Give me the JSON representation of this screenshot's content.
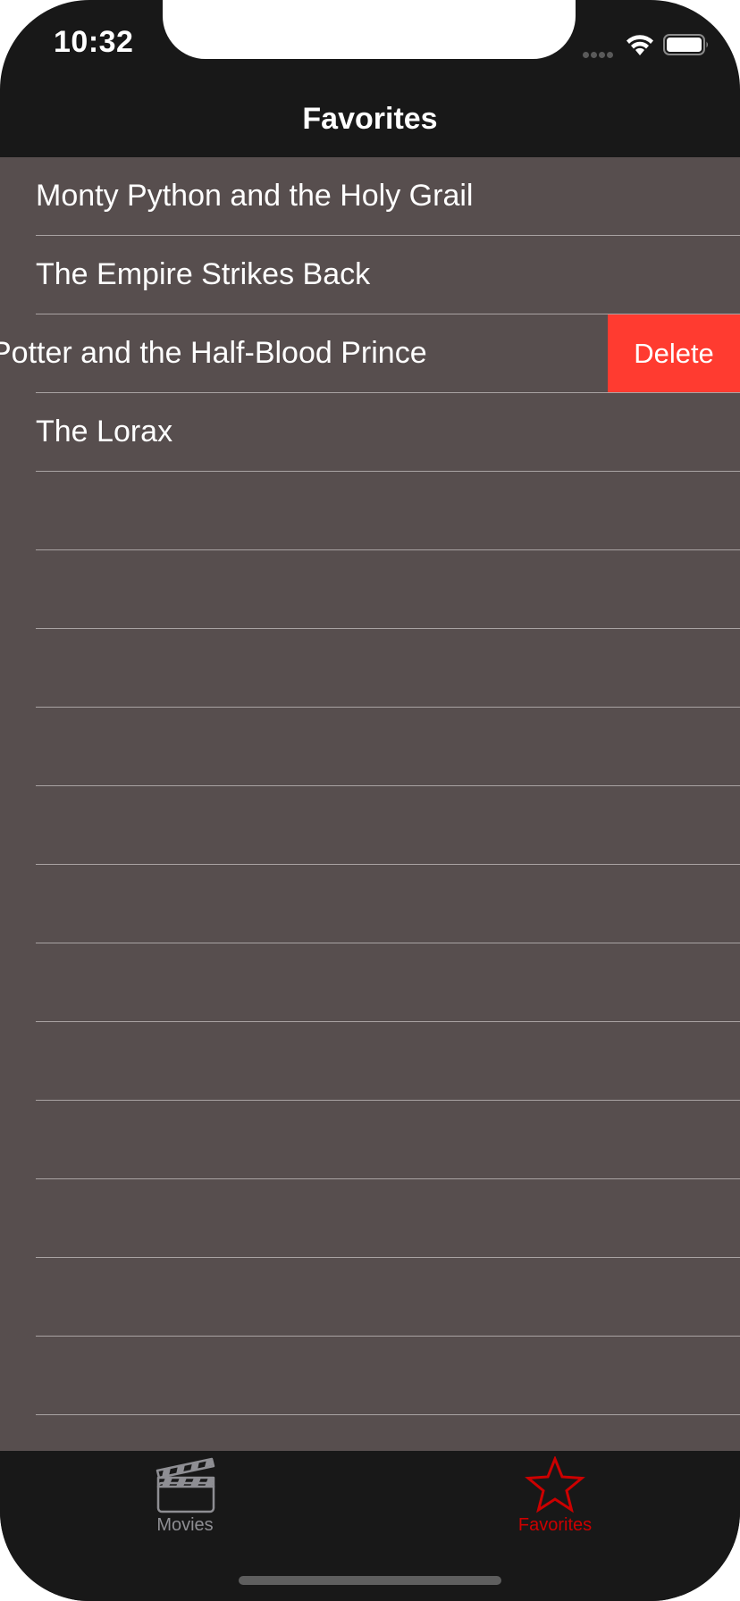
{
  "status_bar": {
    "time": "10:32"
  },
  "nav": {
    "title": "Favorites"
  },
  "favorites": {
    "rows": [
      {
        "title": "Monty Python and the Holy Grail"
      },
      {
        "title": "The Empire Strikes Back"
      },
      {
        "title": "Potter and the Half-Blood Prince",
        "swipe_action": "Delete"
      },
      {
        "title": "The Lorax"
      }
    ],
    "empty_row_count": 12
  },
  "tab_bar": {
    "tabs": [
      {
        "label": "Movies",
        "icon": "clapperboard-icon",
        "selected": false
      },
      {
        "label": "Favorites",
        "icon": "star-icon",
        "selected": true
      }
    ]
  },
  "colors": {
    "background": "#181818",
    "table_background": "#574e4e",
    "delete_red": "#ff3b30",
    "selected_tab": "#cc0000",
    "unselected_tab": "#8e8e93"
  }
}
